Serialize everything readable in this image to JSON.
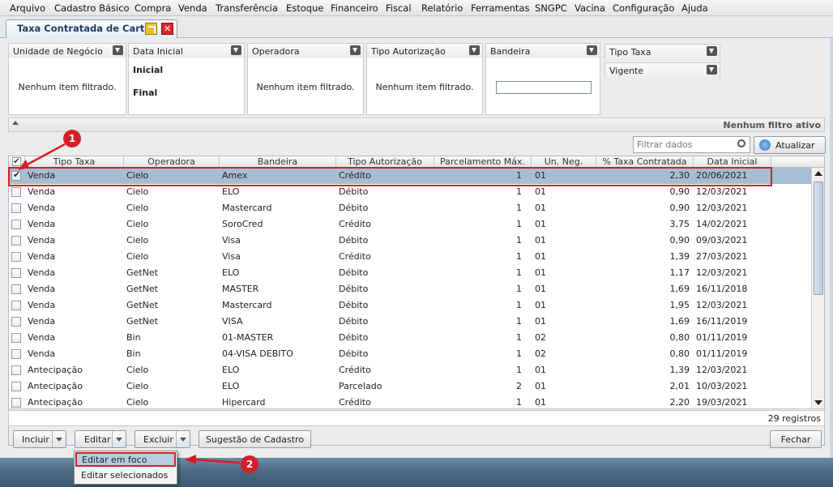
{
  "menu": [
    "Arquivo",
    "Cadastro Básico",
    "Compra",
    "Venda",
    "Transferência",
    "Estoque",
    "Financeiro",
    "Fiscal",
    "Relatório",
    "Ferramentas",
    "SNGPC",
    "Vacina",
    "Configuração",
    "Ajuda"
  ],
  "tab": {
    "title": "Taxa Contratada de Cartão",
    "maximize_icon": "maximize-icon",
    "close_icon": "close-icon"
  },
  "filters": {
    "unidade": {
      "title": "Unidade de Negócio",
      "empty": "Nenhum item filtrado."
    },
    "data": {
      "title": "Data Inicial",
      "start": "Inicial",
      "end": "Final"
    },
    "operadora": {
      "title": "Operadora",
      "empty": "Nenhum item filtrado."
    },
    "tipo_aut": {
      "title": "Tipo Autorização",
      "empty": "Nenhum item filtrado."
    },
    "bandeira": {
      "title": "Bandeira",
      "value": ""
    },
    "tipo_taxa": {
      "title": "Tipo Taxa"
    },
    "vigente": {
      "title": "Vigente"
    }
  },
  "status": {
    "text": "Nenhum filtro ativo"
  },
  "search": {
    "placeholder": "Filtrar dados",
    "refresh": "Atualizar"
  },
  "columns": [
    "Tipo Taxa",
    "Operadora",
    "Bandeira",
    "Tipo Autorização",
    "Parcelamento Máx.",
    "Un. Neg.",
    "% Taxa Contratada",
    "Data Inicial"
  ],
  "rows": [
    {
      "tipo": "Venda",
      "op": "Cielo",
      "band": "Amex",
      "aut": "Crédito",
      "parc": "1",
      "un": "01",
      "taxa": "2,30",
      "data": "20/06/2021",
      "checked": true
    },
    {
      "tipo": "Venda",
      "op": "Cielo",
      "band": "ELO",
      "aut": "Débito",
      "parc": "1",
      "un": "01",
      "taxa": "0,90",
      "data": "12/03/2021",
      "checked": false
    },
    {
      "tipo": "Venda",
      "op": "Cielo",
      "band": "Mastercard",
      "aut": "Débito",
      "parc": "1",
      "un": "01",
      "taxa": "0,90",
      "data": "12/03/2021",
      "checked": false
    },
    {
      "tipo": "Venda",
      "op": "Cielo",
      "band": "SoroCred",
      "aut": "Crédito",
      "parc": "1",
      "un": "01",
      "taxa": "3,75",
      "data": "14/02/2021",
      "checked": false
    },
    {
      "tipo": "Venda",
      "op": "Cielo",
      "band": "Visa",
      "aut": "Débito",
      "parc": "1",
      "un": "01",
      "taxa": "0,90",
      "data": "09/03/2021",
      "checked": false
    },
    {
      "tipo": "Venda",
      "op": "Cielo",
      "band": "Visa",
      "aut": "Crédito",
      "parc": "1",
      "un": "01",
      "taxa": "1,39",
      "data": "27/03/2021",
      "checked": false
    },
    {
      "tipo": "Venda",
      "op": "GetNet",
      "band": "ELO",
      "aut": "Débito",
      "parc": "1",
      "un": "01",
      "taxa": "1,17",
      "data": "12/03/2021",
      "checked": false
    },
    {
      "tipo": "Venda",
      "op": "GetNet",
      "band": "MASTER",
      "aut": "Débito",
      "parc": "1",
      "un": "01",
      "taxa": "1,69",
      "data": "16/11/2018",
      "checked": false
    },
    {
      "tipo": "Venda",
      "op": "GetNet",
      "band": "Mastercard",
      "aut": "Débito",
      "parc": "1",
      "un": "01",
      "taxa": "1,95",
      "data": "12/03/2021",
      "checked": false
    },
    {
      "tipo": "Venda",
      "op": "GetNet",
      "band": "VISA",
      "aut": "Débito",
      "parc": "1",
      "un": "01",
      "taxa": "1,69",
      "data": "16/11/2019",
      "checked": false
    },
    {
      "tipo": "Venda",
      "op": "Bin",
      "band": "01-MASTER",
      "aut": "Débito",
      "parc": "1",
      "un": "02",
      "taxa": "0,80",
      "data": "01/11/2019",
      "checked": false
    },
    {
      "tipo": "Venda",
      "op": "Bin",
      "band": "04-VISA DEBITO",
      "aut": "Débito",
      "parc": "1",
      "un": "02",
      "taxa": "0,80",
      "data": "01/11/2019",
      "checked": false
    },
    {
      "tipo": "Antecipação",
      "op": "Cielo",
      "band": "ELO",
      "aut": "Crédito",
      "parc": "1",
      "un": "01",
      "taxa": "1,39",
      "data": "12/03/2021",
      "checked": false
    },
    {
      "tipo": "Antecipação",
      "op": "Cielo",
      "band": "ELO",
      "aut": "Parcelado",
      "parc": "2",
      "un": "01",
      "taxa": "2,01",
      "data": "10/03/2021",
      "checked": false
    },
    {
      "tipo": "Antecipação",
      "op": "Cielo",
      "band": "Hipercard",
      "aut": "Crédito",
      "parc": "1",
      "un": "01",
      "taxa": "2,20",
      "data": "19/03/2021",
      "checked": false
    }
  ],
  "record_count": "29 registros",
  "buttons": {
    "incluir": "Incluir",
    "editar": "Editar",
    "excluir": "Excluir",
    "sugestao": "Sugestão de Cadastro",
    "fechar": "Fechar"
  },
  "edit_menu": [
    "Editar em foco",
    "Editar selecionados"
  ],
  "callouts": [
    "1",
    "2"
  ],
  "colors": {
    "selected_row": "#a8bcd3",
    "callout": "#d41f26",
    "accent": "#1e3b63"
  }
}
